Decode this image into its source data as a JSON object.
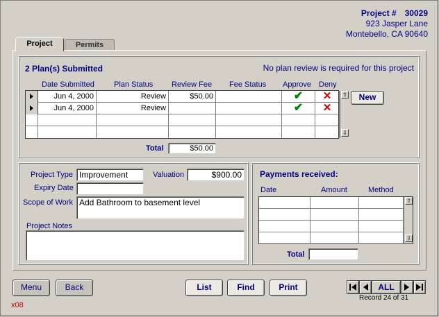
{
  "header": {
    "project_label": "Project #",
    "project_number": "30029",
    "address_line1": "923 Jasper Lane",
    "address_line2": "Montebello, CA 90640"
  },
  "tabs": [
    {
      "label": "Project",
      "active": true
    },
    {
      "label": "Permits",
      "active": false
    }
  ],
  "plans": {
    "title": "2 Plan(s) Submitted",
    "note": "No plan review is required for this project",
    "columns": [
      "Date Submitted",
      "Plan Status",
      "Review Fee",
      "Fee Status",
      "Approve",
      "Deny"
    ],
    "rows": [
      {
        "date": "Jun 4, 2000",
        "status": "Review",
        "fee": "$50.00",
        "fee_status": "",
        "approve": "✔",
        "deny": "✕"
      },
      {
        "date": "Jun 4, 2000",
        "status": "Review",
        "fee": "",
        "fee_status": "",
        "approve": "✔",
        "deny": "✕"
      }
    ],
    "new_button": "New",
    "total_label": "Total",
    "total_value": "$50.00"
  },
  "project": {
    "type_label": "Project Type",
    "type_value": "Improvement",
    "valuation_label": "Valuation",
    "valuation_value": "$900.00",
    "expiry_label": "Expiry Date",
    "expiry_value": "",
    "scope_label": "Scope of Work",
    "scope_value": "Add Bathroom to basement level",
    "notes_label": "Project Notes",
    "notes_value": ""
  },
  "payments": {
    "title": "Payments received:",
    "columns": [
      "Date",
      "Amount",
      "Method"
    ],
    "total_label": "Total",
    "total_value": ""
  },
  "footer": {
    "menu": "Menu",
    "back": "Back",
    "list": "List",
    "find": "Find",
    "print": "Print",
    "all": "ALL",
    "record_text": "Record 24 of 31",
    "code": "x08"
  },
  "colors": {
    "navy": "#000080",
    "approve": "#008000",
    "deny": "#cc0000",
    "background": "#d4d0c8"
  }
}
